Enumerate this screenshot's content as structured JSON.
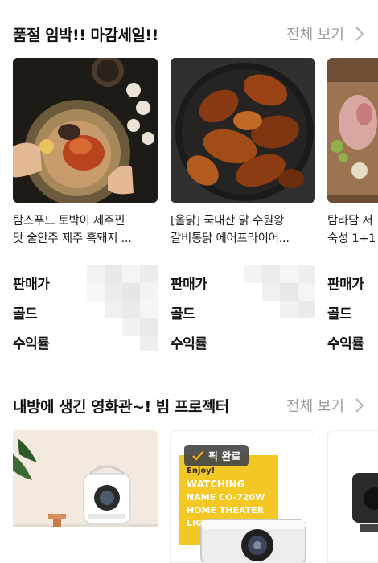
{
  "sections": [
    {
      "title": "품절 임박!! 마감세일!!",
      "see_all": "전체 보기",
      "products": [
        {
          "name_line1": "탐스푸드 토박이 제주찐",
          "name_line2": "맛 술안주 제주 흑돼지 ..."
        },
        {
          "name_line1": "[올닭] 국내산 닭 수원왕",
          "name_line2": "갈비통닭 에어프라이어..."
        },
        {
          "name_line1": "탐라담 저",
          "name_line2": "숙성 1+1"
        }
      ],
      "labels": {
        "price": "판매가",
        "gold": "골드",
        "yield": "수익률"
      }
    },
    {
      "title": "내방에 생긴 영화관~! 빔 프로젝터",
      "see_all": "전체 보기",
      "badge": "픽 완료",
      "poster_lines": [
        "Enjoy!",
        "WATCHING",
        "NAME CO-720W",
        "HOME THEATER",
        "LIGHT UP"
      ]
    }
  ],
  "icons": {
    "chevron": "chevron-right-icon",
    "check": "check-icon"
  },
  "colors": {
    "see_all": "#9a9a9a",
    "badge_bg": "#464646",
    "badge_check": "#f5b400"
  }
}
